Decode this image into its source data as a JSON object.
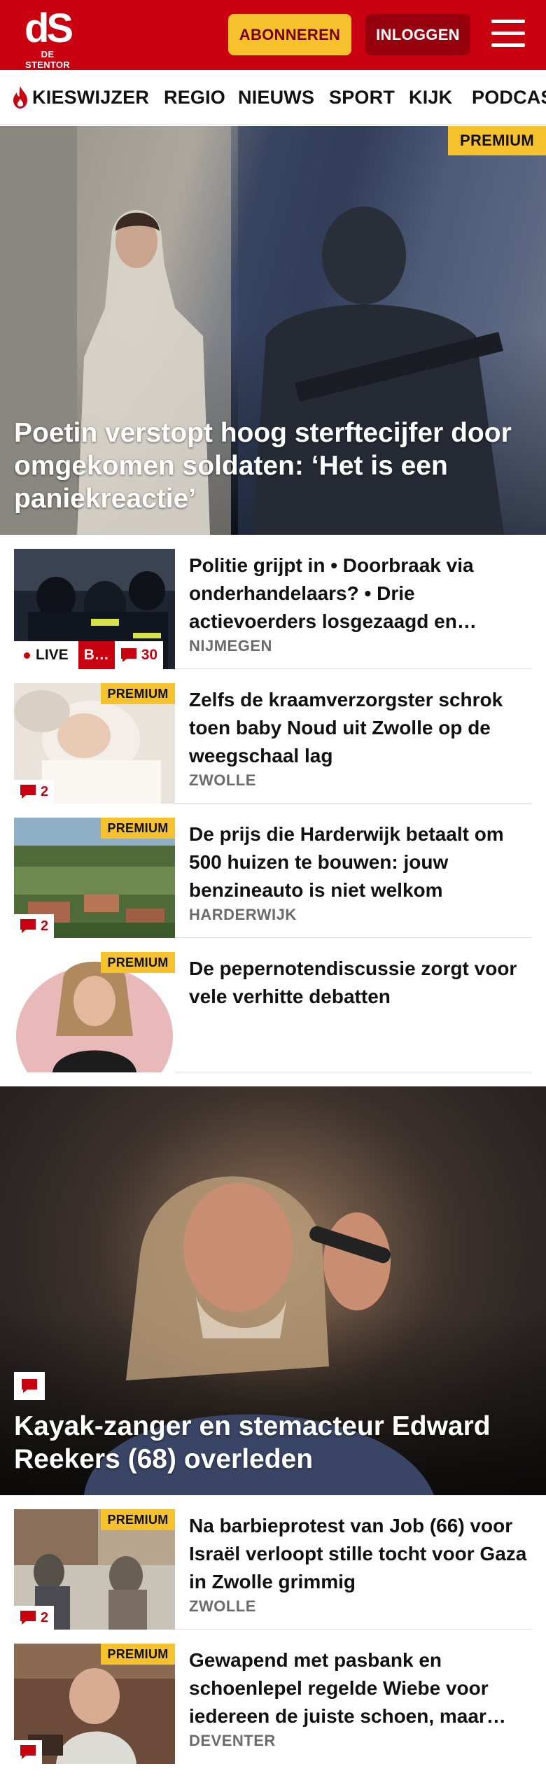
{
  "header": {
    "logo_mark": "dS",
    "logo_name": "DE STENTOR",
    "subscribe_label": "ABONNEREN",
    "login_label": "INLOGGEN",
    "brand_color": "#c8000f",
    "accent_color": "#f5c12c"
  },
  "nav": {
    "items": [
      {
        "label": "KIESWIJZER",
        "icon": "flame-icon"
      },
      {
        "label": "REGIO"
      },
      {
        "label": "NIEUWS"
      },
      {
        "label": "SPORT"
      },
      {
        "label": "KIJK"
      },
      {
        "label": "PODCAS"
      }
    ]
  },
  "hero": {
    "badge": "PREMIUM",
    "title": "Poetin verstopt hoog sterftecijfer door omgekomen soldaten: ‘Het is een paniekreactie’"
  },
  "articles": [
    {
      "title": "Politie grijpt in • Doorbraak via onderhandelaars? • Drie actievoerders losgezaagd en…",
      "location": "NIJMEGEN",
      "live_label": "LIVE",
      "live_tag": "B…",
      "comments": "30"
    },
    {
      "badge": "PREMIUM",
      "title": "Zelfs de kraamverzorgster schrok toen baby Noud uit Zwolle op de weegschaal lag",
      "location": "ZWOLLE",
      "comments": "2"
    },
    {
      "badge": "PREMIUM",
      "title": "De prijs die Harderwijk betaalt om 500 huizen te bouwen: jouw benzineauto is niet welkom",
      "location": "HARDERWIJK",
      "comments": "2"
    },
    {
      "badge": "PREMIUM",
      "title": "De pepernotendiscussie zorgt voor vele verhitte debatten"
    }
  ],
  "feature": {
    "title": "Kayak-zanger en stemacteur Edward Reekers (68) overleden"
  },
  "articles_2": [
    {
      "badge": "PREMIUM",
      "title": "Na barbieprotest van Job (66) voor Israël verloopt stille tocht voor Gaza in Zwolle grimmig",
      "location": "ZWOLLE",
      "comments": "2"
    },
    {
      "badge": "PREMIUM",
      "title": "Gewapend met pasbank en schoenlepel regelde Wiebe voor iedereen de juiste schoen, maar…",
      "location": "DEVENTER"
    }
  ]
}
